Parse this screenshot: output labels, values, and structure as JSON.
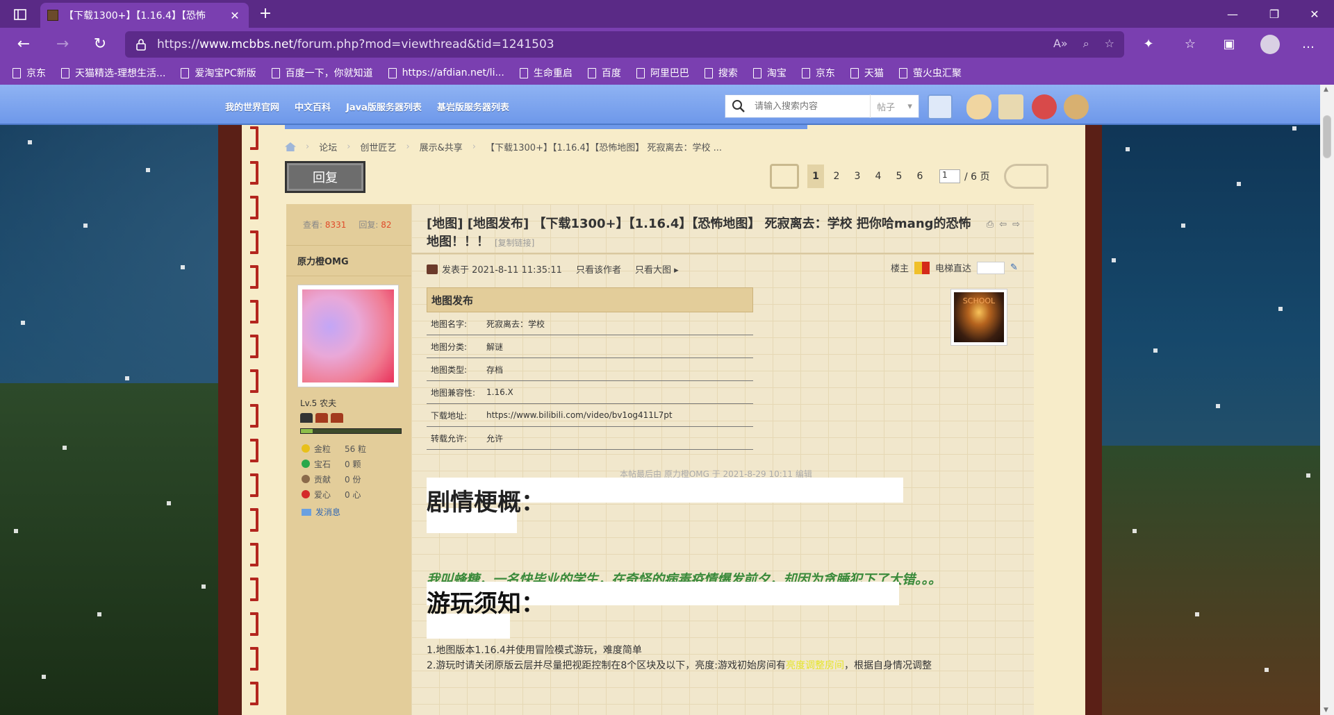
{
  "browser": {
    "tab_title": "【下载1300+】【1.16.4】【恐怖",
    "url_prefix": "https://",
    "url_host": "www.mcbbs.net",
    "url_path": "/forum.php?mod=viewthread&tid=1241503",
    "bookmarks": [
      "京东",
      "天猫精选-理想生活...",
      "爱淘宝PC新版",
      "百度一下，你就知道",
      "https://afdian.net/li...",
      "生命重启",
      "百度",
      "阿里巴巴",
      "搜索",
      "淘宝",
      "京东",
      "天猫",
      "萤火虫汇聚"
    ]
  },
  "site_nav": {
    "links": [
      "我的世界官网",
      "中文百科",
      "Java版服务器列表",
      "基岩版服务器列表"
    ],
    "search_placeholder": "请输入搜索内容",
    "search_scope": "帖子"
  },
  "breadcrumbs": [
    "论坛",
    "创世匠艺",
    "展示&共享",
    "【下载1300+】【1.16.4】【恐怖地图】 死寂离去：学校 ..."
  ],
  "reply_label": "回复",
  "pager": {
    "pages": [
      "1",
      "2",
      "3",
      "4",
      "5",
      "6"
    ],
    "current": "1",
    "input": "1",
    "total": "/ 6 页"
  },
  "stats": {
    "views_label": "查看:",
    "views": "8331",
    "replies_label": "回复:",
    "replies": "82"
  },
  "author": {
    "name": "原力橙OMG",
    "level": "Lv.5 农夫",
    "level_progress": 0.12,
    "items": [
      {
        "label": "金粒",
        "value": "56 粒",
        "color": "#e8c01a"
      },
      {
        "label": "宝石",
        "value": "0 颗",
        "color": "#2aa84a"
      },
      {
        "label": "贡献",
        "value": "0 份",
        "color": "#8a6a4a"
      },
      {
        "label": "爱心",
        "value": "0 心",
        "color": "#d42a2a"
      }
    ],
    "message": "发消息"
  },
  "post": {
    "title": "[地图] [地图发布] 【下载1300+】【1.16.4】【恐怖地图】 死寂离去：学校 把你哈mang的恐怖地图！！！",
    "copy_link": "[复制链接]",
    "posted": "发表于 2021-8-11 11:35:11",
    "only_author": "只看该作者",
    "large_image": "只看大图",
    "floor": "楼主",
    "elevator": "电梯直达",
    "table_header": "地图发布",
    "table": [
      {
        "k": "地图名字:",
        "v": "死寂离去：学校"
      },
      {
        "k": "地图分类:",
        "v": "解谜"
      },
      {
        "k": "地图类型:",
        "v": "存档"
      },
      {
        "k": "地图兼容性:",
        "v": "1.16.X"
      },
      {
        "k": "下载地址:",
        "v": "https://www.bilibili.com/video/bv1og411L7pt"
      },
      {
        "k": "转载允许:",
        "v": "允许"
      }
    ],
    "thumb_text": "SCHOOL",
    "edited": "本帖最后由 原力橙OMG 于 2021-8-29 10:11 编辑",
    "heading1": "剧情梗概：",
    "story": "我叫蜂糖，一名快毕业的学生，在奇怪的病毒疫情爆发前夕，却因为贪睡犯下了大错。。。",
    "heading2": "游玩须知：",
    "rule1": "1.地图版本1.16.4并使用冒险模式游玩，难度简单",
    "rule2_a": "2.游玩时请关闭原版云层并尽量把视距控制在8个区块及以下，亮度:游戏初始房间有",
    "rule2_hl": "亮度调整房间",
    "rule2_b": "，根据自身情况调整"
  }
}
